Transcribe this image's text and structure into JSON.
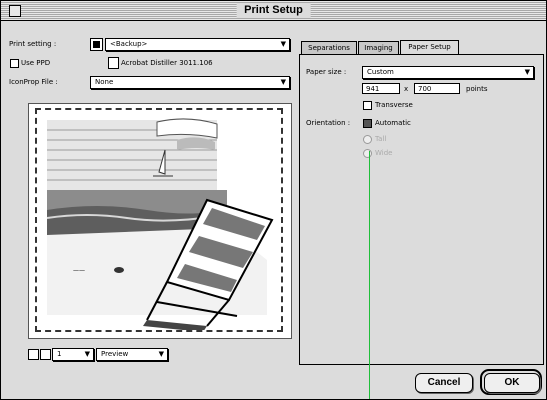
{
  "window": {
    "title": "Print Setup"
  },
  "left": {
    "print_setting_label": "Print setting :",
    "print_setting_value": "<Backup>",
    "use_ppd_label": "Use PPD",
    "ppd_value": "Acrobat Distiller 3011.106",
    "icc_label": "IconProp File :",
    "icc_value": "None",
    "page_number": "1",
    "view_mode": "Preview"
  },
  "tabs": [
    {
      "label": "Separations"
    },
    {
      "label": "Imaging"
    },
    {
      "label": "Paper Setup"
    }
  ],
  "paper": {
    "size_label": "Paper size :",
    "size_value": "Custom",
    "width": "941",
    "height": "700",
    "x_label": "x",
    "units": "points",
    "transverse_label": "Transverse",
    "orientation_label": "Orientation :",
    "auto_label": "Automatic",
    "tall_label": "Tall",
    "wide_label": "Wide"
  },
  "buttons": {
    "cancel": "Cancel",
    "ok": "OK"
  },
  "icons": [
    "close-box-icon",
    "printer-icon",
    "page-icon",
    "chevron-down-icon"
  ]
}
